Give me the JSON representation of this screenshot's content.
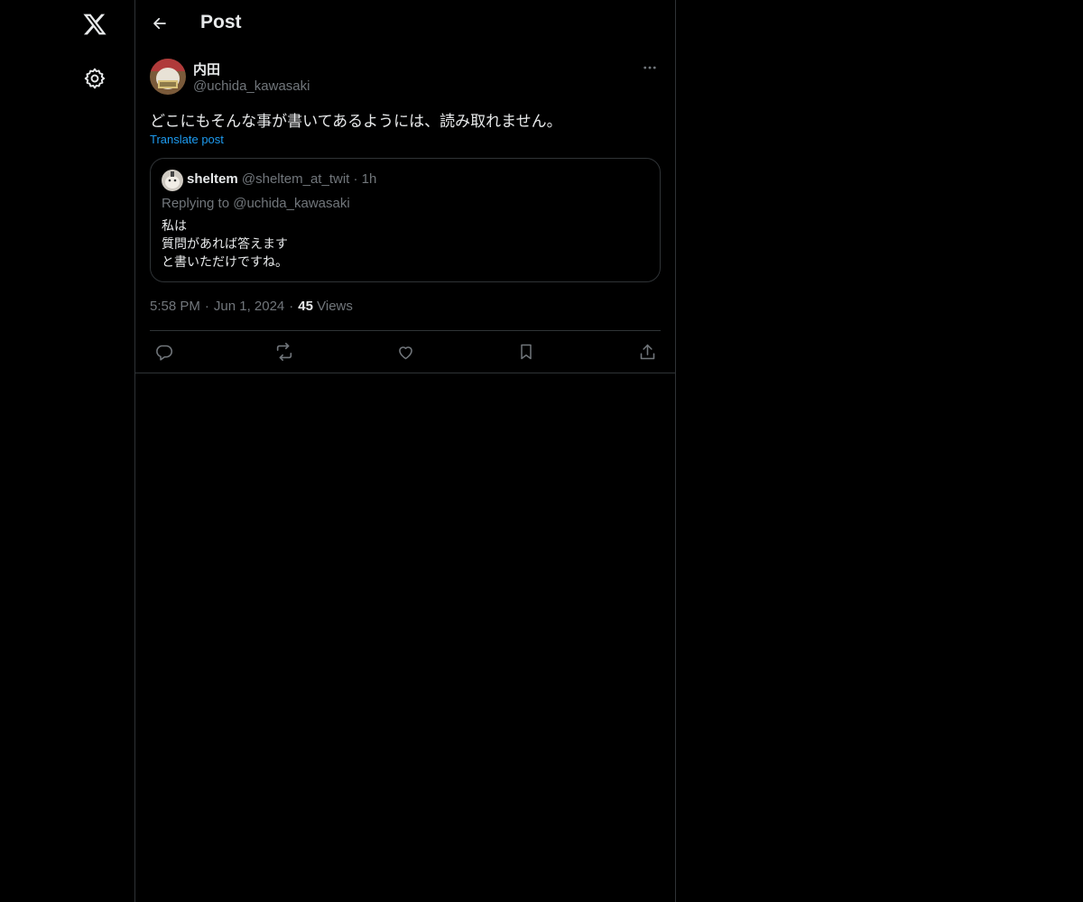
{
  "header": {
    "title": "Post"
  },
  "post": {
    "author_name": "内田",
    "author_handle": "@uchida_kawasaki",
    "text": "どこにもそんな事が書いてあるようには、読み取れません。",
    "translate_label": "Translate post",
    "quote": {
      "author_name": "sheltem",
      "author_handle": "@sheltem_at_twit",
      "dot": "·",
      "time": "1h",
      "replying_to": "Replying to @uchida_kawasaki",
      "lines": [
        "私は",
        "質問があれば答えます",
        "と書いただけですね。"
      ]
    },
    "time": "5:58 PM",
    "date": "Jun 1, 2024",
    "separator": "·",
    "views_count": "45",
    "views_label": "Views"
  },
  "icons": {
    "logo": "x-logo-icon",
    "settings": "gear-icon",
    "back": "arrow-left-icon",
    "more": "more-horizontal-icon",
    "reply": "reply-icon",
    "repost": "repost-icon",
    "like": "heart-icon",
    "bookmark": "bookmark-icon",
    "share": "share-icon"
  },
  "colors": {
    "background": "#000000",
    "text": "#e7e9ea",
    "muted": "#71767b",
    "accent": "#1d9bf0",
    "border": "#2f3336"
  }
}
